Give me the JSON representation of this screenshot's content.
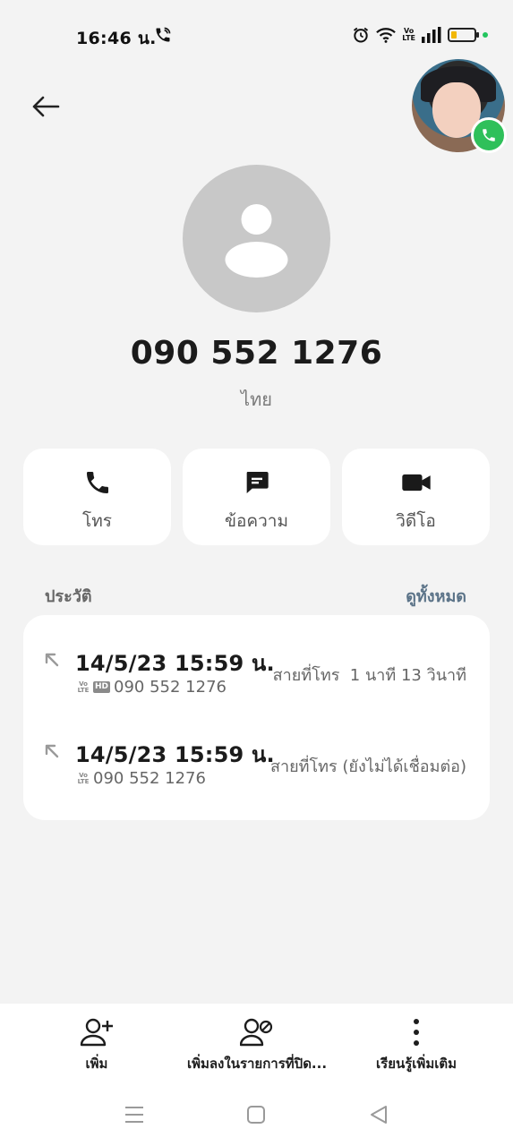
{
  "status_bar": {
    "time": "16:46 น.",
    "volte_label": "Vo\nLTE",
    "battery_level_percent": 25,
    "battery_color": "#f2b705"
  },
  "header": {
    "back_icon": "arrow-left-icon"
  },
  "floating_call_bubble": {
    "call_icon": "phone-icon",
    "accent": "#2fc05a"
  },
  "contact": {
    "phone_number": "090 552 1276",
    "country": "ไทย",
    "avatar_icon": "person-silhouette-icon"
  },
  "actions": [
    {
      "label": "โทร",
      "icon": "phone-icon"
    },
    {
      "label": "ข้อความ",
      "icon": "message-icon"
    },
    {
      "label": "วิดีโอ",
      "icon": "video-icon"
    }
  ],
  "history": {
    "title": "ประวัติ",
    "see_all": "ดูทั้งหมด",
    "entries": [
      {
        "datetime": "14/5/23 15:59 น.",
        "volte": "Vo\nLTE",
        "hd": "HD",
        "number": "090 552 1276",
        "detail": "สายที่โทร  1 นาที 13 วินาที",
        "icon": "outgoing-call-arrow-icon"
      },
      {
        "datetime": "14/5/23 15:59 น.",
        "volte": "Vo\nLTE",
        "number": "090 552 1276",
        "detail": "สายที่โทร (ยังไม่ได้เชื่อมต่อ)",
        "icon": "outgoing-call-arrow-icon"
      }
    ]
  },
  "bottom_actions": [
    {
      "label": "เพิ่ม",
      "icon": "add-contact-icon"
    },
    {
      "label": "เพิ่มลงในรายการที่ปิด...",
      "icon": "block-contact-icon"
    },
    {
      "label": "เรียนรู้เพิ่มเติม",
      "icon": "more-vertical-icon"
    }
  ],
  "nav_bar": {
    "items": [
      "menu-lines-icon",
      "home-square-icon",
      "back-triangle-icon"
    ]
  }
}
